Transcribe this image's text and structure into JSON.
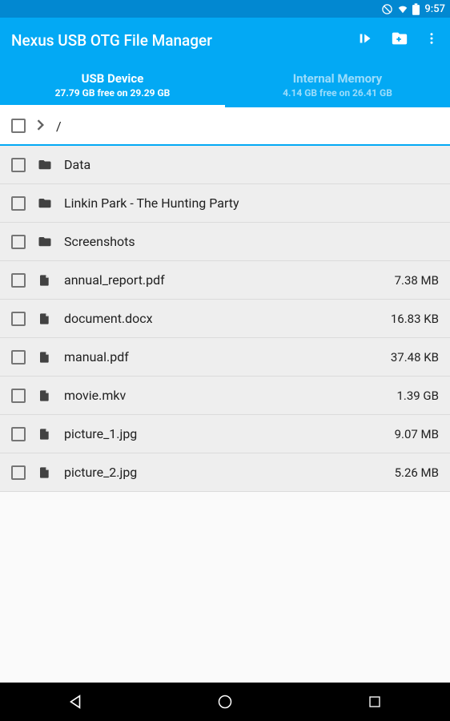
{
  "status": {
    "time": "9:57"
  },
  "app": {
    "title": "Nexus USB OTG File Manager"
  },
  "tabs": [
    {
      "label": "USB Device",
      "sub": "27.79 GB free on 29.29 GB",
      "active": true
    },
    {
      "label": "Internal Memory",
      "sub": "4.14 GB free on 26.41 GB",
      "active": false
    }
  ],
  "path": "/",
  "files": [
    {
      "type": "folder",
      "name": "Data",
      "size": ""
    },
    {
      "type": "folder",
      "name": "Linkin Park - The Hunting Party",
      "size": ""
    },
    {
      "type": "folder",
      "name": "Screenshots",
      "size": ""
    },
    {
      "type": "file",
      "name": "annual_report.pdf",
      "size": "7.38 MB"
    },
    {
      "type": "file",
      "name": "document.docx",
      "size": "16.83 KB"
    },
    {
      "type": "file",
      "name": "manual.pdf",
      "size": "37.48 KB"
    },
    {
      "type": "file",
      "name": "movie.mkv",
      "size": "1.39 GB"
    },
    {
      "type": "file",
      "name": "picture_1.jpg",
      "size": "9.07 MB"
    },
    {
      "type": "file",
      "name": "picture_2.jpg",
      "size": "5.26 MB"
    }
  ]
}
